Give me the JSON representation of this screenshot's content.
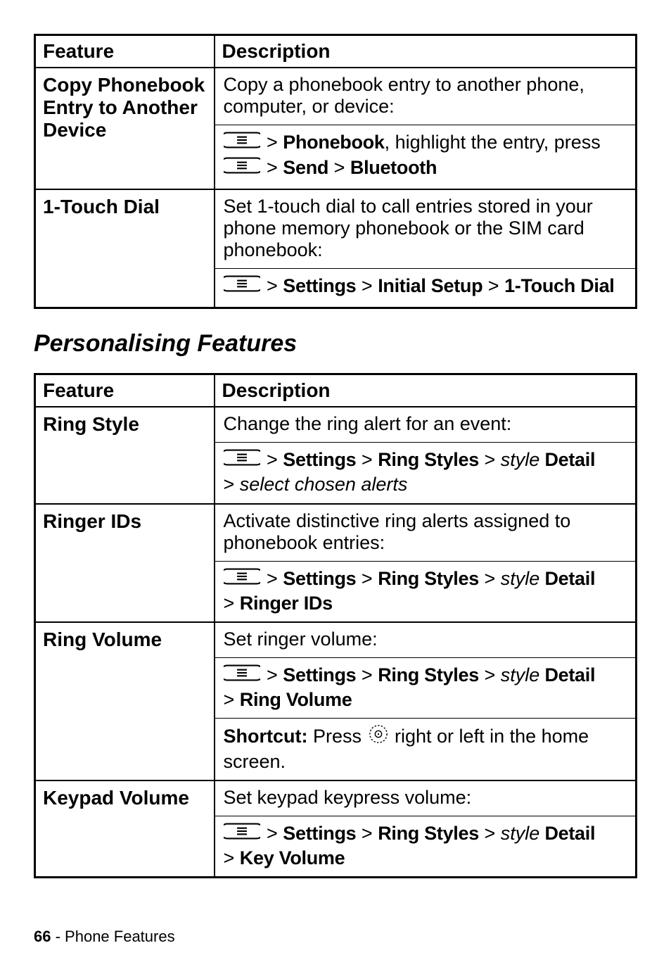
{
  "table1": {
    "header_feature": "Feature",
    "header_desc": "Description",
    "rows": [
      {
        "feature": "Copy Phonebook Entry to Another Device",
        "desc1": "Copy a phonebook entry to another phone, computer, or device:",
        "path1_a": "Phonebook",
        "path1_mid": ", highlight the entry, press ",
        "path1_b": "Send",
        "path1_c": "Bluetooth"
      },
      {
        "feature": "1-Touch Dial",
        "desc1": "Set 1-touch dial to call entries stored in your phone memory phonebook or the SIM card phonebook:",
        "path_a": "Settings",
        "path_b": "Initial Setup",
        "path_c": "1-Touch Dial"
      }
    ]
  },
  "section_title": "Personalising Features",
  "table2": {
    "header_feature": "Feature",
    "header_desc": "Description",
    "rows": [
      {
        "feature": "Ring Style",
        "desc1": "Change the ring alert for an event:",
        "pa": "Settings",
        "pb": "Ring Styles",
        "pc_style": "style",
        "pc_detail": " Detail",
        "tail_italic": "select chosen alerts"
      },
      {
        "feature": "Ringer IDs",
        "desc1": "Activate distinctive ring alerts assigned to phonebook entries:",
        "pa": "Settings",
        "pb": "Ring Styles",
        "pc_style": "style",
        "pc_detail": " Detail",
        "tail": "Ringer IDs"
      },
      {
        "feature": "Ring Volume",
        "desc1": "Set ringer volume:",
        "pa": "Settings",
        "pb": "Ring Styles",
        "pc_style": "style",
        "pc_detail": " Detail",
        "tail": "Ring Volume",
        "shortcut_label": "Shortcut:",
        "shortcut_a": " Press ",
        "shortcut_b": " right or left in the home screen."
      },
      {
        "feature": "Keypad Volume",
        "desc1": "Set keypad keypress volume:",
        "pa": "Settings",
        "pb": "Ring Styles",
        "pc_style": "style",
        "pc_detail": " Detail",
        "tail": "Key Volume"
      }
    ]
  },
  "footer": {
    "page": "66",
    "sep": " - ",
    "section": "Phone Features"
  },
  "gt": " > "
}
